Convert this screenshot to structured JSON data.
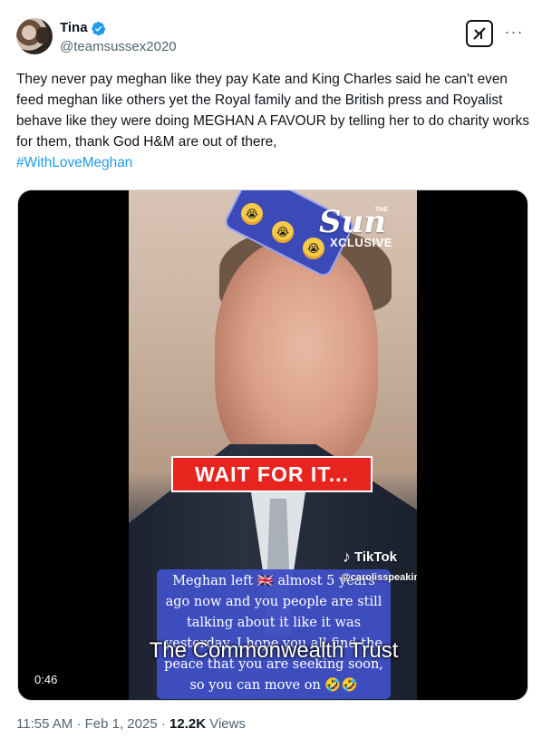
{
  "author": {
    "display_name": "Tina",
    "handle": "@teamsussex2020",
    "verified": true,
    "verified_color": "#1d9bf0"
  },
  "actions": {
    "grok_icon": "grok-icon",
    "more_label": "···"
  },
  "tweet": {
    "text": "They never pay meghan like they pay Kate and King Charles said he can't even feed meghan like others yet the Royal family and the British press and Royalist behave like they were doing MEGHAN A FAVOUR by telling her to do charity works for them, thank God H&M are out of there,",
    "hashtag": "#WithLoveMeghan",
    "hashtag_color": "#1d9bf0"
  },
  "media": {
    "sun_small": "THE",
    "sun_logo": "Sun",
    "sun_sub": "XCLUSIVE",
    "banner": "WAIT FOR IT...",
    "banner_color": "#e8241f",
    "tiktok_label": "TikTok",
    "tiktok_user": "@carolisspeaking",
    "caption": "Meghan left 🇬🇧 almost 5 years ago now and you people are still talking about it like it was yesterday. I hope you all find the peace that you are seeking soon, so you can move on 🤣🤣",
    "subtitle": "The Commonwealth Trust",
    "duration": "0:46"
  },
  "meta": {
    "time": "11:55 AM",
    "date": "Feb 1, 2025",
    "views_count": "12.2K",
    "views_label": "Views"
  }
}
